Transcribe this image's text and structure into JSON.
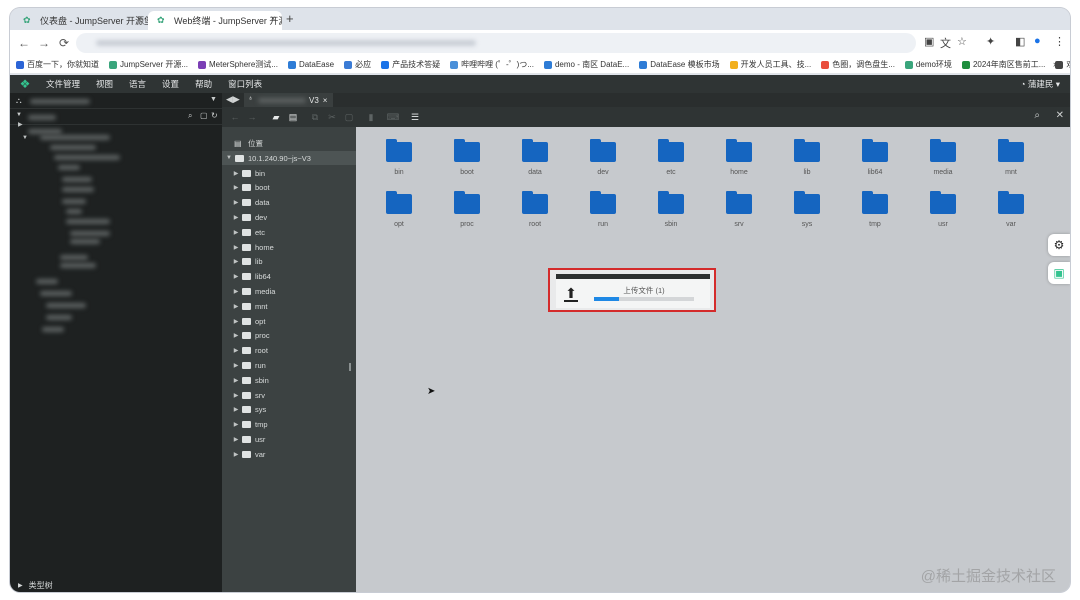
{
  "browser": {
    "tabs": [
      {
        "title": "仪表盘 - JumpServer 开源堡垒",
        "active": false
      },
      {
        "title": "Web终端 - JumpServer 开源堡",
        "active": true
      }
    ],
    "new_tab": "+",
    "nav": {
      "back": "←",
      "forward": "→",
      "reload": "⟳"
    }
  },
  "bookmarks": [
    {
      "label": "百度一下，你就知道",
      "color": "#2b64d6"
    },
    {
      "label": "JumpServer 开源...",
      "color": "#3aa57c"
    },
    {
      "label": "MeterSphere测试...",
      "color": "#7b3fb5"
    },
    {
      "label": "DataEase",
      "color": "#2e7cd6"
    },
    {
      "label": "必应",
      "color": "#3a7bd5"
    },
    {
      "label": "产品技术答疑",
      "color": "#1a73e8"
    },
    {
      "label": "哔哩哔哩 (゜-゜)つ...",
      "color": "#4a90d9"
    },
    {
      "label": "demo - 南区 DataE...",
      "color": "#2e7cd6"
    },
    {
      "label": "DataEase 模板市场",
      "color": "#2e7cd6"
    },
    {
      "label": "开发人员工具、技...",
      "color": "#f2b01e"
    },
    {
      "label": "色圈，调色盘生...",
      "color": "#e94e3c"
    },
    {
      "label": "demo环境",
      "color": "#3aa57c"
    },
    {
      "label": "2024年南区售前工...",
      "color": "#1e8e3e"
    },
    {
      "label": "欢迎使用 VMware...",
      "color": "#444444"
    }
  ],
  "app_menu": {
    "items": [
      "文件管理",
      "视图",
      "语言",
      "设置",
      "帮助",
      "窗口列表"
    ],
    "user": "蒲建民"
  },
  "left_pane": {
    "bottom_label": "类型树"
  },
  "session": {
    "tab_title": "V3",
    "close": "×"
  },
  "tree": {
    "location_label": "位置",
    "root": "10.1.240.90~js~V3",
    "folders": [
      "bin",
      "boot",
      "data",
      "dev",
      "etc",
      "home",
      "lib",
      "lib64",
      "media",
      "mnt",
      "opt",
      "proc",
      "root",
      "run",
      "sbin",
      "srv",
      "sys",
      "tmp",
      "usr",
      "var"
    ]
  },
  "content": {
    "folders": [
      "bin",
      "boot",
      "data",
      "dev",
      "etc",
      "home",
      "lib",
      "lib64",
      "media",
      "mnt",
      "opt",
      "proc",
      "root",
      "run",
      "sbin",
      "srv",
      "sys",
      "tmp",
      "usr",
      "var"
    ]
  },
  "upload": {
    "title": "上传文件 (1)",
    "progress_percent": 25
  },
  "colors": {
    "folder": "#1565c0",
    "highlight": "#d42b2b",
    "progress": "#1e88e5",
    "accent": "#34c38f"
  },
  "watermark": "@稀土掘金技术社区"
}
